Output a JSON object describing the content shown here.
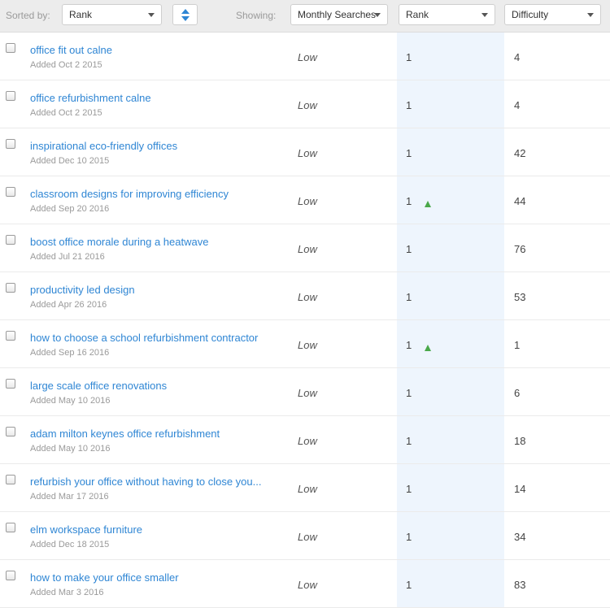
{
  "toolbar": {
    "sorted_by_label": "Sorted by:",
    "sort_value": "Rank",
    "showing_label": "Showing:",
    "columns": [
      {
        "label": "Monthly Searches"
      },
      {
        "label": "Rank"
      },
      {
        "label": "Difficulty"
      }
    ]
  },
  "colors": {
    "link": "#2f86d4",
    "rank_column_bg": "#eef5fd",
    "trend_up": "#4aa84a",
    "toolbar_bg": "#ececec"
  },
  "rows": [
    {
      "keyword": "office fit out calne",
      "added": "Added Oct 2 2015",
      "monthly_searches": "Low",
      "rank": "1",
      "trend_up": false,
      "difficulty": "4"
    },
    {
      "keyword": "office refurbishment calne",
      "added": "Added Oct 2 2015",
      "monthly_searches": "Low",
      "rank": "1",
      "trend_up": false,
      "difficulty": "4"
    },
    {
      "keyword": "inspirational eco-friendly offices",
      "added": "Added Dec 10 2015",
      "monthly_searches": "Low",
      "rank": "1",
      "trend_up": false,
      "difficulty": "42"
    },
    {
      "keyword": "classroom designs for improving efficiency",
      "added": "Added Sep 20 2016",
      "monthly_searches": "Low",
      "rank": "1",
      "trend_up": true,
      "difficulty": "44"
    },
    {
      "keyword": "boost office morale during a heatwave",
      "added": "Added Jul 21 2016",
      "monthly_searches": "Low",
      "rank": "1",
      "trend_up": false,
      "difficulty": "76"
    },
    {
      "keyword": "productivity led design",
      "added": "Added Apr 26 2016",
      "monthly_searches": "Low",
      "rank": "1",
      "trend_up": false,
      "difficulty": "53"
    },
    {
      "keyword": "how to choose a school refurbishment contractor",
      "added": "Added Sep 16 2016",
      "monthly_searches": "Low",
      "rank": "1",
      "trend_up": true,
      "difficulty": "1"
    },
    {
      "keyword": "large scale office renovations",
      "added": "Added May 10 2016",
      "monthly_searches": "Low",
      "rank": "1",
      "trend_up": false,
      "difficulty": "6"
    },
    {
      "keyword": "adam milton keynes office refurbishment",
      "added": "Added May 10 2016",
      "monthly_searches": "Low",
      "rank": "1",
      "trend_up": false,
      "difficulty": "18"
    },
    {
      "keyword": "refurbish your office without having to close you...",
      "added": "Added Mar 17 2016",
      "monthly_searches": "Low",
      "rank": "1",
      "trend_up": false,
      "difficulty": "14"
    },
    {
      "keyword": "elm workspace furniture",
      "added": "Added Dec 18 2015",
      "monthly_searches": "Low",
      "rank": "1",
      "trend_up": false,
      "difficulty": "34"
    },
    {
      "keyword": "how to make your office smaller",
      "added": "Added Mar 3 2016",
      "monthly_searches": "Low",
      "rank": "1",
      "trend_up": false,
      "difficulty": "83"
    }
  ]
}
